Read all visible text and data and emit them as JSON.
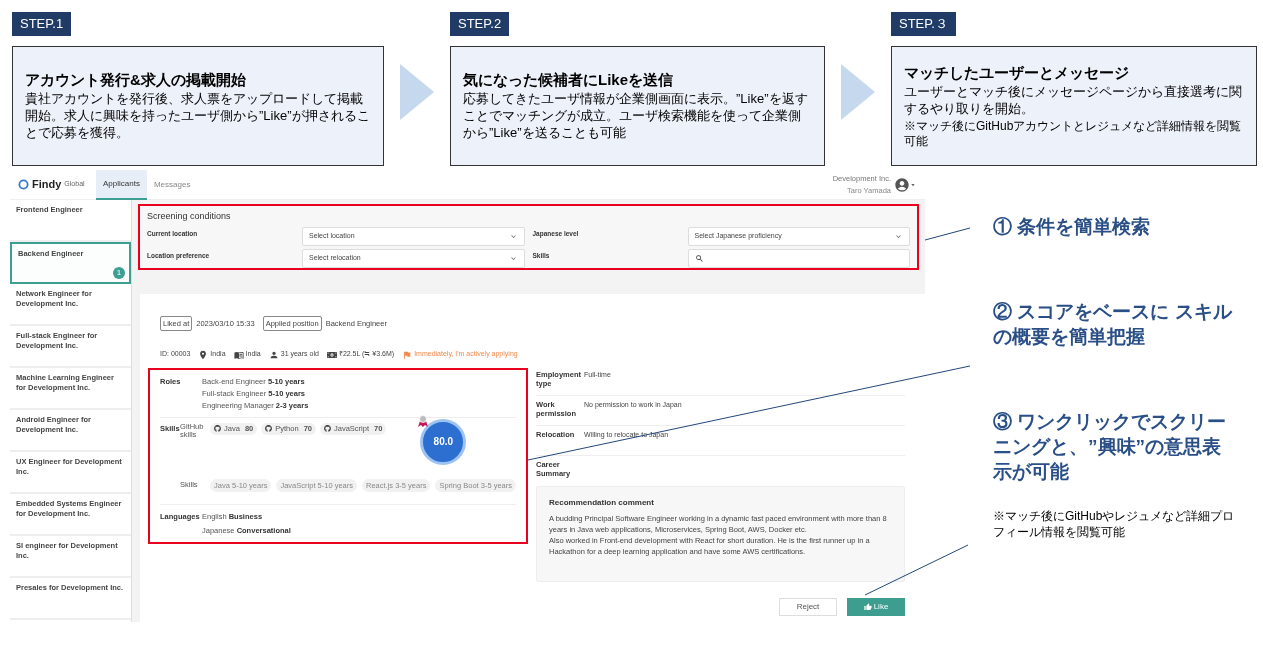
{
  "steps": [
    {
      "label": "STEP.1",
      "title": "アカウント発行&求人の掲載開始",
      "body": "貴社アカウントを発行後、求人票をアップロードして掲載開始。求人に興味を持ったユーザ側から”Like”が押されることで応募を獲得。"
    },
    {
      "label": "STEP.2",
      "title": "気になった候補者にLikeを送信",
      "body": "応募してきたユーザ情報が企業側画面に表示。”Like”を返すことでマッチングが成立。ユーザ検索機能を使って企業側から”Like”を送ることも可能"
    },
    {
      "label": "STEP.３",
      "title": "マッチしたユーザーとメッセージ",
      "body": "ユーザーとマッチ後にメッセージページから直接選考に関するやり取りを開始。",
      "note": "※マッチ後にGitHubアカウントとレジュメなど詳細情報を閲覧可能"
    }
  ],
  "app": {
    "brand": {
      "name": "Findy",
      "sub": "Global"
    },
    "tabs": [
      {
        "label": "Applicants",
        "selected": true
      },
      {
        "label": "Messages",
        "selected": false
      }
    ],
    "user": {
      "company": "Development Inc.",
      "name": "Taro Yamada"
    },
    "sidebar": {
      "items": [
        {
          "label": "Frontend Engineer",
          "selected": false
        },
        {
          "label": "Backend Engineer",
          "selected": true,
          "badge": "1"
        },
        {
          "label": "Network Engineer for Development Inc.",
          "selected": false
        },
        {
          "label": "Full-stack Engineer for Development Inc.",
          "selected": false
        },
        {
          "label": "Machine Learning Engineer for Development Inc.",
          "selected": false
        },
        {
          "label": "Android Engineer for Development Inc.",
          "selected": false
        },
        {
          "label": "UX Engineer for Development Inc.",
          "selected": false
        },
        {
          "label": "Embedded Systems Engineer for Development Inc.",
          "selected": false
        },
        {
          "label": "SI engineer for Development Inc.",
          "selected": false
        },
        {
          "label": "Presales for Development Inc.",
          "selected": false
        }
      ]
    },
    "screening": {
      "title": "Screening conditions",
      "fields": [
        {
          "label": "Current location",
          "kind": "select",
          "placeholder": "Select location"
        },
        {
          "label": "Japanese level",
          "kind": "select",
          "placeholder": "Select Japanese proficiency"
        },
        {
          "label": "Location preference",
          "kind": "select",
          "placeholder": "Select relocation"
        },
        {
          "label": "Skills",
          "kind": "search"
        }
      ]
    },
    "candidate": {
      "liked_label": "Liked at",
      "liked_at": "2023/03/10 15:33",
      "position_label": "Applied position",
      "position": "Backend Engineer",
      "meta": [
        {
          "kind": "id",
          "text": "ID: 00003"
        },
        {
          "kind": "location",
          "text": "India"
        },
        {
          "kind": "nationality",
          "text": "India"
        },
        {
          "kind": "age",
          "text": "31 years old"
        },
        {
          "kind": "salary",
          "text": "₹22.5L (≒ ¥3.6M)"
        },
        {
          "kind": "status",
          "text": "Immediately, I'm actively applying"
        }
      ],
      "roles_label": "Roles",
      "roles": [
        {
          "name": "Back-end Engineer",
          "years": "5-10 years"
        },
        {
          "name": "Full-stack Engineer",
          "years": "5-10 years"
        },
        {
          "name": "Engineering Manager",
          "years": "2-3 years"
        }
      ],
      "skills_label": "Skills",
      "github_label": "GitHub skills",
      "github_skills": [
        {
          "name": "Java",
          "score": "80"
        },
        {
          "name": "Python",
          "score": "70"
        },
        {
          "name": "JavaScript",
          "score": "70"
        }
      ],
      "score": "80.0",
      "tags_label": "Skills",
      "tags": [
        "Java 5-10 years",
        "JavaScript 5-10 years",
        "React.js 3-5 years",
        "Spring Boot 3-5 years"
      ],
      "languages_label": "Languages",
      "languages": [
        {
          "name": "English",
          "level": "Business"
        },
        {
          "name": "Japanese",
          "level": "Conversational"
        }
      ],
      "details": [
        {
          "label": "Employment type",
          "value": "Full-time"
        },
        {
          "label": "Work permission",
          "value": "No permission to work in Japan"
        },
        {
          "label": "Relocation",
          "value": "Willing to relocate to Japan"
        },
        {
          "label": "Career Summary"
        }
      ],
      "recommendation": {
        "title": "Recommendation comment",
        "paragraphs": [
          "A budding Principal Software Engineer working in a dynamic fast paced environment with more than 8 years in Java web applications, Microservices, Spring Boot, AWS, Docker etc.",
          "Also worked in Front-end development with React for short duration. He is the first runner up in a Hackathon for a deep learning application and have some AWS certifications."
        ]
      },
      "buttons": [
        {
          "kind": "reject",
          "label": "Reject"
        },
        {
          "kind": "like",
          "label": "Like"
        }
      ]
    }
  },
  "callouts": [
    {
      "kind": "heading",
      "text": "① 条件を簡単検索"
    },
    {
      "kind": "heading",
      "text": "② スコアをベースに スキルの概要を簡単把握"
    },
    {
      "kind": "heading",
      "text": "③ ワンクリックでスクリーニングと、”興味”の意思表示が可能"
    },
    {
      "kind": "note",
      "text": "※マッチ後にGitHubやレジュメなど詳細プロフィール情報を閲覧可能"
    }
  ]
}
